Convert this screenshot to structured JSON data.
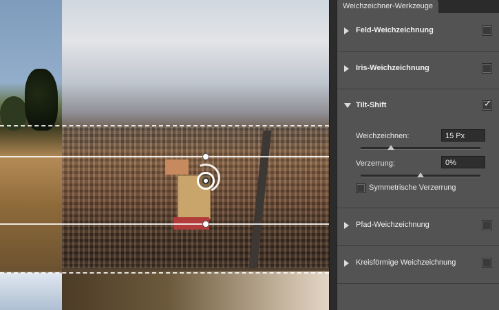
{
  "panel": {
    "tab_title": "Weichzeichner-Werkzeuge",
    "sections": [
      {
        "label": "Feld-Weichzeichnung",
        "expanded": false,
        "checked": false
      },
      {
        "label": "Iris-Weichzeichnung",
        "expanded": false,
        "checked": false
      },
      {
        "label": "Tilt-Shift",
        "expanded": true,
        "checked": true
      },
      {
        "label": "Pfad-Weichzeichnung",
        "expanded": false,
        "checked": false
      },
      {
        "label": "Kreisförmige Weichzeichnung",
        "expanded": false,
        "checked": false
      }
    ],
    "tilt_shift": {
      "weichzeichnen_label": "Weichzeichnen:",
      "weichzeichnen_value": "15 Px",
      "weichzeichnen_slider_fraction": 0.25,
      "verzerrung_label": "Verzerrung:",
      "verzerrung_value": "0%",
      "verzerrung_slider_fraction": 0.5,
      "symmetrisch_label": "Symmetrische Verzerrung",
      "symmetrisch_checked": false
    }
  },
  "colors": {
    "panel_bg": "#535353",
    "header_bg": "#2b2b2b",
    "text": "#f0f0f0"
  },
  "icons": {
    "collapsed": "triangle-right-icon",
    "expanded": "triangle-down-icon",
    "checked": "checkmark-icon",
    "blur_pin": "blur-pin-icon"
  }
}
